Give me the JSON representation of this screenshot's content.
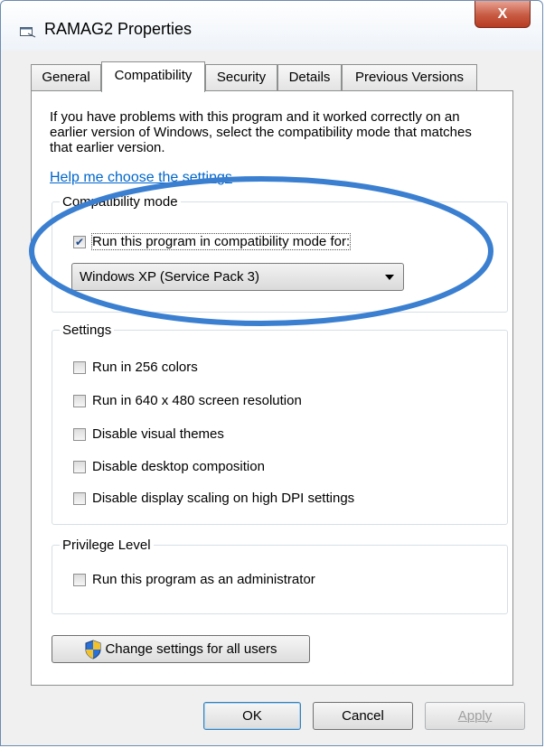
{
  "window": {
    "title": "RAMAG2 Properties",
    "close_label": "X"
  },
  "tabs": [
    {
      "label": "General"
    },
    {
      "label": "Compatibility"
    },
    {
      "label": "Security"
    },
    {
      "label": "Details"
    },
    {
      "label": "Previous Versions"
    }
  ],
  "active_tab": "Compatibility",
  "intro_text": "If you have problems with this program and it worked correctly on an earlier version of Windows, select the compatibility mode that matches that earlier version.",
  "help_link": "Help me choose the settings",
  "compat_mode": {
    "legend": "Compatibility mode",
    "checkbox_label": "Run this program in compatibility mode for:",
    "checked": true,
    "selected_os": "Windows XP (Service Pack 3)"
  },
  "settings": {
    "legend": "Settings",
    "options": [
      {
        "label": "Run in 256 colors",
        "checked": false
      },
      {
        "label": "Run in 640 x 480 screen resolution",
        "checked": false
      },
      {
        "label": "Disable visual themes",
        "checked": false
      },
      {
        "label": "Disable desktop composition",
        "checked": false
      },
      {
        "label": "Disable display scaling on high DPI settings",
        "checked": false
      }
    ]
  },
  "privilege": {
    "legend": "Privilege Level",
    "checkbox_label": "Run this program as an administrator",
    "checked": false
  },
  "change_all_users_label": "Change settings for all users",
  "buttons": {
    "ok": "OK",
    "cancel": "Cancel",
    "apply": "Apply"
  },
  "colors": {
    "link": "#0066cc",
    "annotation_ellipse": "#3b7fd1",
    "close_button": "#c75a42"
  }
}
